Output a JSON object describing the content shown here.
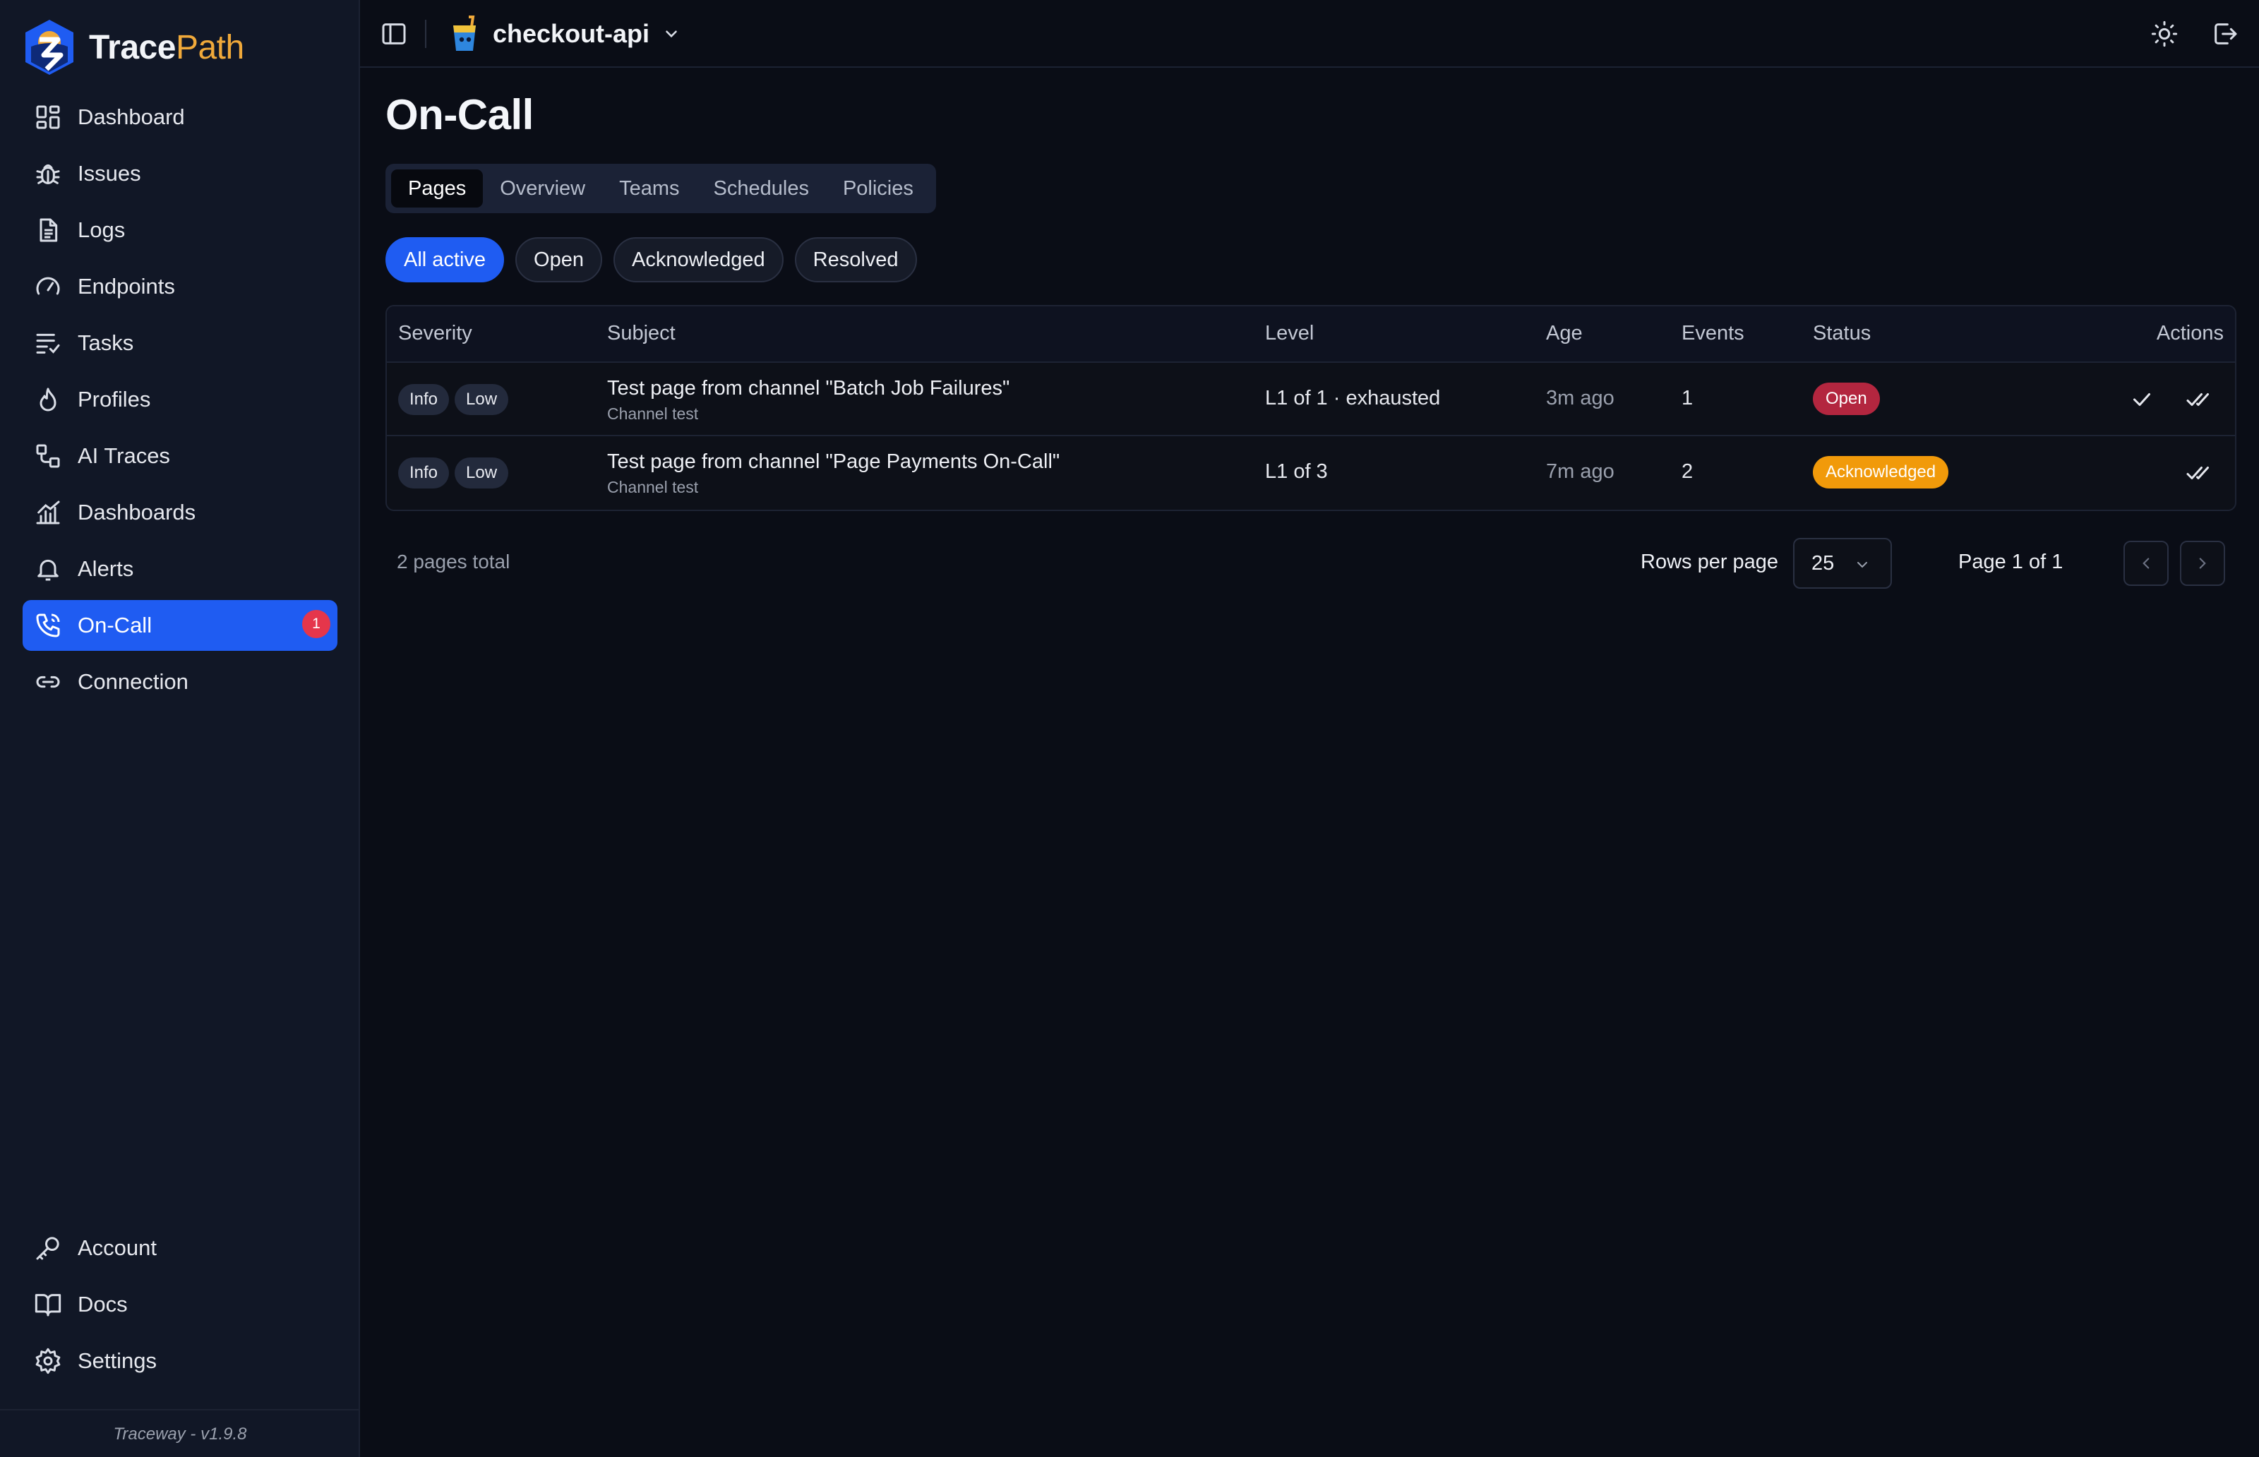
{
  "brand": {
    "name_part1": "Trace",
    "name_part2": "Path"
  },
  "sidebar": {
    "items": [
      {
        "label": "Dashboard",
        "icon": "layout-grid-icon"
      },
      {
        "label": "Issues",
        "icon": "bug-icon"
      },
      {
        "label": "Logs",
        "icon": "file-text-icon"
      },
      {
        "label": "Endpoints",
        "icon": "gauge-icon"
      },
      {
        "label": "Tasks",
        "icon": "list-checks-icon"
      },
      {
        "label": "Profiles",
        "icon": "flame-icon"
      },
      {
        "label": "AI Traces",
        "icon": "route-icon"
      },
      {
        "label": "Dashboards",
        "icon": "chart-icon"
      },
      {
        "label": "Alerts",
        "icon": "bell-icon"
      },
      {
        "label": "On-Call",
        "icon": "phone-icon",
        "active": true,
        "badge": "1"
      },
      {
        "label": "Connection",
        "icon": "link-icon"
      }
    ],
    "bottom_items": [
      {
        "label": "Account",
        "icon": "key-icon"
      },
      {
        "label": "Docs",
        "icon": "book-icon"
      },
      {
        "label": "Settings",
        "icon": "gear-icon"
      }
    ],
    "version": "Traceway - v1.9.8"
  },
  "topbar": {
    "project": "checkout-api"
  },
  "page": {
    "title": "On-Call",
    "tabs": [
      "Pages",
      "Overview",
      "Teams",
      "Schedules",
      "Policies"
    ],
    "active_tab": "Pages",
    "filters": [
      "All active",
      "Open",
      "Acknowledged",
      "Resolved"
    ],
    "active_filter": "All active"
  },
  "table": {
    "columns": [
      "Severity",
      "Subject",
      "Level",
      "Age",
      "Events",
      "Status",
      "Actions"
    ],
    "rows": [
      {
        "severity": "Info",
        "priority": "Low",
        "subject": "Test page from channel \"Batch Job Failures\"",
        "source": "Channel test",
        "level": "L1 of 1 · exhausted",
        "age": "3m ago",
        "events": "1",
        "status": "Open"
      },
      {
        "severity": "Info",
        "priority": "Low",
        "subject": "Test page from channel \"Page Payments On-Call\"",
        "source": "Channel test",
        "level": "L1 of 3",
        "age": "7m ago",
        "events": "2",
        "status": "Acknowledged"
      }
    ]
  },
  "pagination": {
    "total": "2 pages total",
    "rows_per_page_label": "Rows per page",
    "rows_per_page": "25",
    "page_of": "Page 1 of 1"
  },
  "colors": {
    "accent": "#1f5cf2",
    "open": "#b3263f",
    "acknowledged": "#f19a0a",
    "brand_orange": "#f0a93a"
  }
}
